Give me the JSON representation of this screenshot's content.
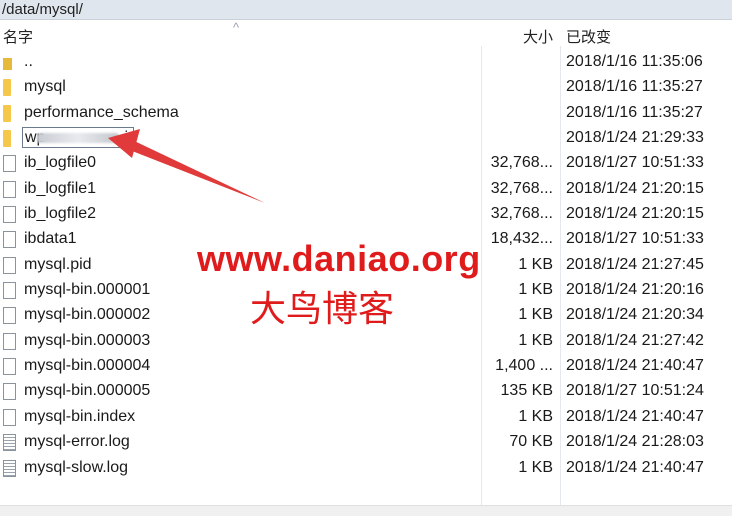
{
  "path": "/data/mysql/",
  "columns": {
    "name": "名字",
    "size": "大小",
    "modified": "已改变"
  },
  "rows": [
    {
      "type": "up",
      "icon": "parent-folder-icon",
      "name": "..",
      "size": "",
      "modified": "2018/1/16 11:35:06"
    },
    {
      "type": "folder",
      "icon": "folder-icon",
      "name": "mysql",
      "size": "",
      "modified": "2018/1/16 11:35:27"
    },
    {
      "type": "folder",
      "icon": "folder-icon",
      "name": "performance_schema",
      "size": "",
      "modified": "2018/1/16 11:35:27"
    },
    {
      "type": "rename",
      "icon": "folder-icon",
      "name": "wp",
      "name_end": "i",
      "size": "",
      "modified": "2018/1/24 21:29:33"
    },
    {
      "type": "file",
      "icon": "file-icon",
      "name": "ib_logfile0",
      "size": "32,768...",
      "modified": "2018/1/27 10:51:33"
    },
    {
      "type": "file",
      "icon": "file-icon",
      "name": "ib_logfile1",
      "size": "32,768...",
      "modified": "2018/1/24 21:20:15"
    },
    {
      "type": "file",
      "icon": "file-icon",
      "name": "ib_logfile2",
      "size": "32,768...",
      "modified": "2018/1/24 21:20:15"
    },
    {
      "type": "file",
      "icon": "file-icon",
      "name": "ibdata1",
      "size": "18,432...",
      "modified": "2018/1/27 10:51:33"
    },
    {
      "type": "file",
      "icon": "file-icon",
      "name": "mysql.pid",
      "size": "1 KB",
      "modified": "2018/1/24 21:27:45"
    },
    {
      "type": "file",
      "icon": "file-icon",
      "name": "mysql-bin.000001",
      "size": "1 KB",
      "modified": "2018/1/24 21:20:16"
    },
    {
      "type": "file",
      "icon": "file-icon",
      "name": "mysql-bin.000002",
      "size": "1 KB",
      "modified": "2018/1/24 21:20:34"
    },
    {
      "type": "file",
      "icon": "file-icon",
      "name": "mysql-bin.000003",
      "size": "1 KB",
      "modified": "2018/1/24 21:27:42"
    },
    {
      "type": "file",
      "icon": "file-icon",
      "name": "mysql-bin.000004",
      "size": "1,400 ...",
      "modified": "2018/1/24 21:40:47"
    },
    {
      "type": "file",
      "icon": "file-icon",
      "name": "mysql-bin.000005",
      "size": "135 KB",
      "modified": "2018/1/27 10:51:24"
    },
    {
      "type": "file",
      "icon": "file-icon",
      "name": "mysql-bin.index",
      "size": "1 KB",
      "modified": "2018/1/24 21:40:47"
    },
    {
      "type": "log",
      "icon": "log-file-icon",
      "name": "mysql-error.log",
      "size": "70 KB",
      "modified": "2018/1/24 21:28:03"
    },
    {
      "type": "log",
      "icon": "log-file-icon",
      "name": "mysql-slow.log",
      "size": "1 KB",
      "modified": "2018/1/24 21:40:47"
    }
  ],
  "watermark": {
    "url": "www.daniao.org",
    "cn": "大鸟博客"
  },
  "colors": {
    "accent": "#e01b1b",
    "folder": "#f5c84c",
    "pathbar": "#dfe6ee"
  }
}
